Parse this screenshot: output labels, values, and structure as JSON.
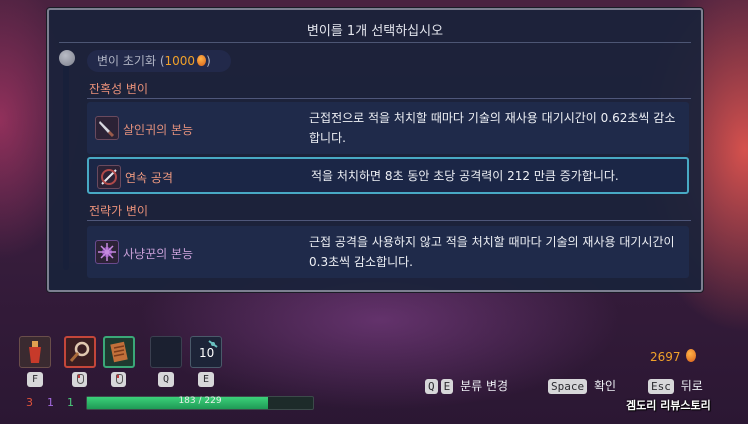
{
  "dialog": {
    "title": "변이를 1개 선택하십시오",
    "reset": {
      "label": "변이 초기화 (",
      "cost": "1000",
      "close": ")"
    },
    "sections": [
      {
        "title": "잔혹성 변이",
        "mutations": [
          {
            "name": "살인귀의 본능",
            "desc": "근접전으로 적을 처치할 때마다 기술의 재사용 대기시간이 0.62초씩 감소합니다.",
            "icon": "dagger-icon",
            "selected": false
          },
          {
            "name": "연속 공격",
            "desc": "적을 처치하면 8초 동안 초당 공격력이 212 만큼 증가합니다.",
            "icon": "slash-icon",
            "selected": true
          }
        ]
      },
      {
        "title": "전략가 변이",
        "mutations": [
          {
            "name": "사냥꾼의 본능",
            "desc": "근접 공격을 사용하지 않고 적을 처치할 때마다 기술의 재사용 대기시간이 0.3초씩 감소합니다.",
            "icon": "spiked-orb-icon",
            "selected": false
          }
        ]
      }
    ]
  },
  "hud": {
    "slots": [
      {
        "key": "F",
        "icon": "flask-icon"
      },
      {
        "key": "mouse-left",
        "icon": "magnifier-weapon-icon"
      },
      {
        "key": "mouse-right",
        "icon": "scroll-weapon-icon"
      },
      {
        "key": "Q",
        "icon": "empty-slot"
      },
      {
        "key": "E",
        "icon": "turret-icon",
        "count": "10"
      }
    ],
    "stats": {
      "brutality": "3",
      "tactics": "1",
      "survival": "1"
    },
    "health": {
      "current": 183,
      "max": 229,
      "text": "183 / 229"
    },
    "gold": "2697",
    "hints": [
      {
        "keys": [
          "Q",
          "E"
        ],
        "label": "분류 변경"
      },
      {
        "keys": [
          "Space"
        ],
        "label": "확인"
      },
      {
        "keys": [
          "Esc"
        ],
        "label": "뒤로"
      }
    ]
  },
  "watermark": "겜도리 리뷰스토리",
  "colors": {
    "accent_select": "#48a9c4",
    "brutality": "#e2907c",
    "gold": "#f0a12a",
    "health": "#2fbf6a"
  }
}
